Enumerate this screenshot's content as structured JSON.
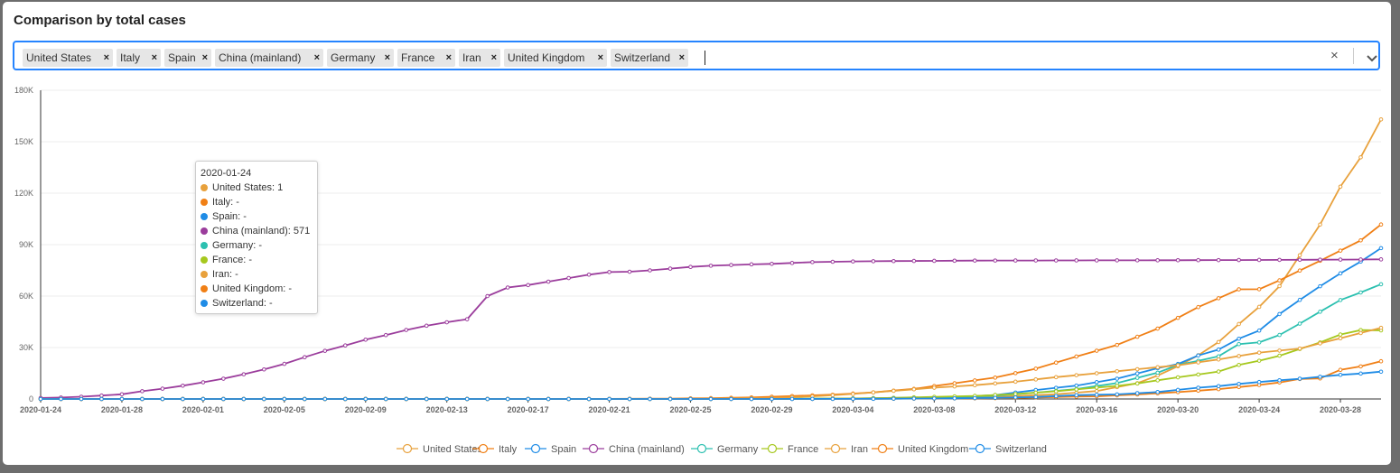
{
  "header": {
    "title": "Comparison by total cases"
  },
  "selector": {
    "tags": [
      {
        "label": "United States",
        "remove": "×"
      },
      {
        "label": "Italy",
        "remove": "×"
      },
      {
        "label": "Spain",
        "remove": "×"
      },
      {
        "label": "China (mainland)",
        "remove": "×"
      },
      {
        "label": "Germany",
        "remove": "×"
      },
      {
        "label": "France",
        "remove": "×"
      },
      {
        "label": "Iran",
        "remove": "×"
      },
      {
        "label": "United Kingdom",
        "remove": "×"
      },
      {
        "label": "Switzerland",
        "remove": "×"
      }
    ],
    "clear_icon": "×"
  },
  "tooltip": {
    "date": "2020-01-24",
    "rows": [
      "United States: 1",
      "Italy: -",
      "Spain: -",
      "China (mainland): 571",
      "Germany: -",
      "France: -",
      "Iran: -",
      "United Kingdom: -",
      "Switzerland: -"
    ]
  },
  "chart_data": {
    "type": "line",
    "title": "Comparison by total cases",
    "xlabel": "",
    "ylabel": "",
    "x_start": "2020-01-24",
    "x_end": "2020-03-30",
    "ylim": [
      0,
      180000
    ],
    "yticks": [
      0,
      30000,
      60000,
      90000,
      120000,
      150000,
      180000
    ],
    "ytick_labels": [
      "0",
      "30K",
      "60K",
      "90K",
      "120K",
      "150K",
      "180K"
    ],
    "xtick_labels": [
      "2020-01-24",
      "2020-01-28",
      "2020-02-01",
      "2020-02-05",
      "2020-02-09",
      "2020-02-13",
      "2020-02-17",
      "2020-02-21",
      "2020-02-25",
      "2020-02-29",
      "2020-03-04",
      "2020-03-08",
      "2020-03-12",
      "2020-03-16",
      "2020-03-20",
      "2020-03-24",
      "2020-03-28"
    ],
    "legend_position": "bottom",
    "series": [
      {
        "name": "United States",
        "color": "#e8a13c",
        "points": [
          [
            "2020-01-24",
            1
          ],
          [
            "2020-02-24",
            53
          ],
          [
            "2020-03-01",
            75
          ],
          [
            "2020-03-05",
            230
          ],
          [
            "2020-03-08",
            540
          ],
          [
            "2020-03-10",
            990
          ],
          [
            "2020-03-12",
            1660
          ],
          [
            "2020-03-14",
            2730
          ],
          [
            "2020-03-16",
            4630
          ],
          [
            "2020-03-18",
            9200
          ],
          [
            "2020-03-19",
            13700
          ],
          [
            "2020-03-20",
            19100
          ],
          [
            "2020-03-21",
            25500
          ],
          [
            "2020-03-22",
            33200
          ],
          [
            "2020-03-23",
            43700
          ],
          [
            "2020-03-24",
            53700
          ],
          [
            "2020-03-25",
            65800
          ],
          [
            "2020-03-26",
            83800
          ],
          [
            "2020-03-27",
            101700
          ],
          [
            "2020-03-28",
            123800
          ],
          [
            "2020-03-29",
            140900
          ],
          [
            "2020-03-30",
            163000
          ]
        ]
      },
      {
        "name": "Italy",
        "color": "#f07f15",
        "points": [
          [
            "2020-01-24",
            0
          ],
          [
            "2020-02-20",
            3
          ],
          [
            "2020-02-22",
            79
          ],
          [
            "2020-02-24",
            229
          ],
          [
            "2020-02-26",
            470
          ],
          [
            "2020-02-28",
            888
          ],
          [
            "2020-03-01",
            1694
          ],
          [
            "2020-03-03",
            2502
          ],
          [
            "2020-03-05",
            3858
          ],
          [
            "2020-03-07",
            5883
          ],
          [
            "2020-03-09",
            9172
          ],
          [
            "2020-03-11",
            12462
          ],
          [
            "2020-03-13",
            17660
          ],
          [
            "2020-03-15",
            24747
          ],
          [
            "2020-03-17",
            31506
          ],
          [
            "2020-03-19",
            41035
          ],
          [
            "2020-03-21",
            53578
          ],
          [
            "2020-03-23",
            63927
          ],
          [
            "2020-03-24",
            64000
          ],
          [
            "2020-03-25",
            69176
          ],
          [
            "2020-03-27",
            80589
          ],
          [
            "2020-03-28",
            86498
          ],
          [
            "2020-03-29",
            92472
          ],
          [
            "2020-03-30",
            101739
          ]
        ]
      },
      {
        "name": "Spain",
        "color": "#1f8ce6",
        "points": [
          [
            "2020-01-24",
            0
          ],
          [
            "2020-02-25",
            2
          ],
          [
            "2020-03-01",
            84
          ],
          [
            "2020-03-03",
            165
          ],
          [
            "2020-03-05",
            282
          ],
          [
            "2020-03-07",
            525
          ],
          [
            "2020-03-09",
            1073
          ],
          [
            "2020-03-11",
            2277
          ],
          [
            "2020-03-13",
            5232
          ],
          [
            "2020-03-15",
            7798
          ],
          [
            "2020-03-17",
            11826
          ],
          [
            "2020-03-19",
            17963
          ],
          [
            "2020-03-20",
            20410
          ],
          [
            "2020-03-21",
            25374
          ],
          [
            "2020-03-22",
            28768
          ],
          [
            "2020-03-23",
            35136
          ],
          [
            "2020-03-24",
            39885
          ],
          [
            "2020-03-25",
            49515
          ],
          [
            "2020-03-26",
            57786
          ],
          [
            "2020-03-27",
            65719
          ],
          [
            "2020-03-28",
            73235
          ],
          [
            "2020-03-29",
            80110
          ],
          [
            "2020-03-30",
            87956
          ]
        ]
      },
      {
        "name": "China (mainland)",
        "color": "#9b3d9c",
        "points": [
          [
            "2020-01-24",
            571
          ],
          [
            "2020-01-25",
            830
          ],
          [
            "2020-01-26",
            1297
          ],
          [
            "2020-01-27",
            1985
          ],
          [
            "2020-01-28",
            2761
          ],
          [
            "2020-01-29",
            4537
          ],
          [
            "2020-01-30",
            5997
          ],
          [
            "2020-01-31",
            7736
          ],
          [
            "2020-02-01",
            9720
          ],
          [
            "2020-02-02",
            11821
          ],
          [
            "2020-02-03",
            14411
          ],
          [
            "2020-02-04",
            17238
          ],
          [
            "2020-02-05",
            20471
          ],
          [
            "2020-02-06",
            24363
          ],
          [
            "2020-02-07",
            28060
          ],
          [
            "2020-02-08",
            31211
          ],
          [
            "2020-02-09",
            34598
          ],
          [
            "2020-02-10",
            37251
          ],
          [
            "2020-02-11",
            40235
          ],
          [
            "2020-02-12",
            42708
          ],
          [
            "2020-02-13",
            44730
          ],
          [
            "2020-02-14",
            46500
          ],
          [
            "2020-02-15",
            60000
          ],
          [
            "2020-02-16",
            65000
          ],
          [
            "2020-02-17",
            66400
          ],
          [
            "2020-02-18",
            68400
          ],
          [
            "2020-02-19",
            70500
          ],
          [
            "2020-02-20",
            72500
          ],
          [
            "2020-02-21",
            74000
          ],
          [
            "2020-02-22",
            74200
          ],
          [
            "2020-02-23",
            75000
          ],
          [
            "2020-02-24",
            76000
          ],
          [
            "2020-02-25",
            77000
          ],
          [
            "2020-02-26",
            77700
          ],
          [
            "2020-02-27",
            78100
          ],
          [
            "2020-02-28",
            78500
          ],
          [
            "2020-02-29",
            78800
          ],
          [
            "2020-03-01",
            79300
          ],
          [
            "2020-03-02",
            79800
          ],
          [
            "2020-03-03",
            80000
          ],
          [
            "2020-03-04",
            80200
          ],
          [
            "2020-03-06",
            80400
          ],
          [
            "2020-03-10",
            80700
          ],
          [
            "2020-03-15",
            80800
          ],
          [
            "2020-03-20",
            80900
          ],
          [
            "2020-03-25",
            81100
          ],
          [
            "2020-03-30",
            81400
          ]
        ]
      },
      {
        "name": "Germany",
        "color": "#2cc0b0",
        "points": [
          [
            "2020-01-24",
            0
          ],
          [
            "2020-01-28",
            1
          ],
          [
            "2020-02-25",
            16
          ],
          [
            "2020-02-28",
            48
          ],
          [
            "2020-03-01",
            130
          ],
          [
            "2020-03-03",
            196
          ],
          [
            "2020-03-05",
            482
          ],
          [
            "2020-03-07",
            799
          ],
          [
            "2020-03-09",
            1176
          ],
          [
            "2020-03-11",
            1908
          ],
          [
            "2020-03-13",
            3675
          ],
          [
            "2020-03-15",
            5813
          ],
          [
            "2020-03-17",
            9257
          ],
          [
            "2020-03-18",
            12327
          ],
          [
            "2020-03-19",
            15320
          ],
          [
            "2020-03-20",
            19848
          ],
          [
            "2020-03-21",
            22213
          ],
          [
            "2020-03-22",
            24873
          ],
          [
            "2020-03-23",
            32000
          ],
          [
            "2020-03-24",
            32986
          ],
          [
            "2020-03-25",
            37323
          ],
          [
            "2020-03-26",
            43938
          ],
          [
            "2020-03-27",
            50871
          ],
          [
            "2020-03-28",
            57695
          ],
          [
            "2020-03-29",
            62095
          ],
          [
            "2020-03-30",
            66885
          ]
        ]
      },
      {
        "name": "France",
        "color": "#a6c81e",
        "points": [
          [
            "2020-01-24",
            2
          ],
          [
            "2020-02-25",
            14
          ],
          [
            "2020-02-29",
            100
          ],
          [
            "2020-03-02",
            191
          ],
          [
            "2020-03-04",
            285
          ],
          [
            "2020-03-06",
            656
          ],
          [
            "2020-03-08",
            1209
          ],
          [
            "2020-03-10",
            1791
          ],
          [
            "2020-03-12",
            2876
          ],
          [
            "2020-03-14",
            4480
          ],
          [
            "2020-03-16",
            6633
          ],
          [
            "2020-03-17",
            7652
          ],
          [
            "2020-03-18",
            9043
          ],
          [
            "2020-03-19",
            10871
          ],
          [
            "2020-03-20",
            12612
          ],
          [
            "2020-03-21",
            14282
          ],
          [
            "2020-03-22",
            16018
          ],
          [
            "2020-03-23",
            19856
          ],
          [
            "2020-03-24",
            22304
          ],
          [
            "2020-03-25",
            25233
          ],
          [
            "2020-03-26",
            29155
          ],
          [
            "2020-03-27",
            32964
          ],
          [
            "2020-03-28",
            37575
          ],
          [
            "2020-03-29",
            40174
          ],
          [
            "2020-03-30",
            40000
          ]
        ]
      },
      {
        "name": "Iran",
        "color": "#e8a13c",
        "points": [
          [
            "2020-01-24",
            0
          ],
          [
            "2020-02-19",
            2
          ],
          [
            "2020-02-23",
            43
          ],
          [
            "2020-02-26",
            139
          ],
          [
            "2020-02-29",
            593
          ],
          [
            "2020-03-02",
            1501
          ],
          [
            "2020-03-04",
            2922
          ],
          [
            "2020-03-06",
            4747
          ],
          [
            "2020-03-08",
            6566
          ],
          [
            "2020-03-10",
            8042
          ],
          [
            "2020-03-12",
            10075
          ],
          [
            "2020-03-14",
            12729
          ],
          [
            "2020-03-16",
            14991
          ],
          [
            "2020-03-18",
            17361
          ],
          [
            "2020-03-20",
            19644
          ],
          [
            "2020-03-22",
            23049
          ],
          [
            "2020-03-24",
            27017
          ],
          [
            "2020-03-26",
            29406
          ],
          [
            "2020-03-28",
            35408
          ],
          [
            "2020-03-30",
            41495
          ]
        ]
      },
      {
        "name": "United Kingdom",
        "color": "#f07f15",
        "points": [
          [
            "2020-01-24",
            0
          ],
          [
            "2020-01-31",
            2
          ],
          [
            "2020-02-29",
            23
          ],
          [
            "2020-03-04",
            87
          ],
          [
            "2020-03-06",
            164
          ],
          [
            "2020-03-08",
            277
          ],
          [
            "2020-03-10",
            383
          ],
          [
            "2020-03-12",
            593
          ],
          [
            "2020-03-14",
            1144
          ],
          [
            "2020-03-16",
            1550
          ],
          [
            "2020-03-18",
            2630
          ],
          [
            "2020-03-20",
            3983
          ],
          [
            "2020-03-22",
            5741
          ],
          [
            "2020-03-24",
            8164
          ],
          [
            "2020-03-25",
            9640
          ],
          [
            "2020-03-26",
            11658
          ],
          [
            "2020-03-27",
            12000
          ],
          [
            "2020-03-28",
            17000
          ],
          [
            "2020-03-29",
            19000
          ],
          [
            "2020-03-30",
            22000
          ]
        ]
      },
      {
        "name": "Switzerland",
        "color": "#1f8ce6",
        "points": [
          [
            "2020-01-24",
            0
          ],
          [
            "2020-02-25",
            1
          ],
          [
            "2020-02-28",
            8
          ],
          [
            "2020-03-01",
            27
          ],
          [
            "2020-03-03",
            56
          ],
          [
            "2020-03-05",
            90
          ],
          [
            "2020-03-07",
            268
          ],
          [
            "2020-03-09",
            374
          ],
          [
            "2020-03-11",
            652
          ],
          [
            "2020-03-13",
            1139
          ],
          [
            "2020-03-15",
            2200
          ],
          [
            "2020-03-17",
            2700
          ],
          [
            "2020-03-19",
            4075
          ],
          [
            "2020-03-20",
            5294
          ],
          [
            "2020-03-21",
            6575
          ],
          [
            "2020-03-22",
            7474
          ],
          [
            "2020-03-23",
            8795
          ],
          [
            "2020-03-24",
            9877
          ],
          [
            "2020-03-25",
            10897
          ],
          [
            "2020-03-26",
            11811
          ],
          [
            "2020-03-27",
            12928
          ],
          [
            "2020-03-28",
            14076
          ],
          [
            "2020-03-29",
            14829
          ],
          [
            "2020-03-30",
            15922
          ]
        ]
      }
    ]
  }
}
